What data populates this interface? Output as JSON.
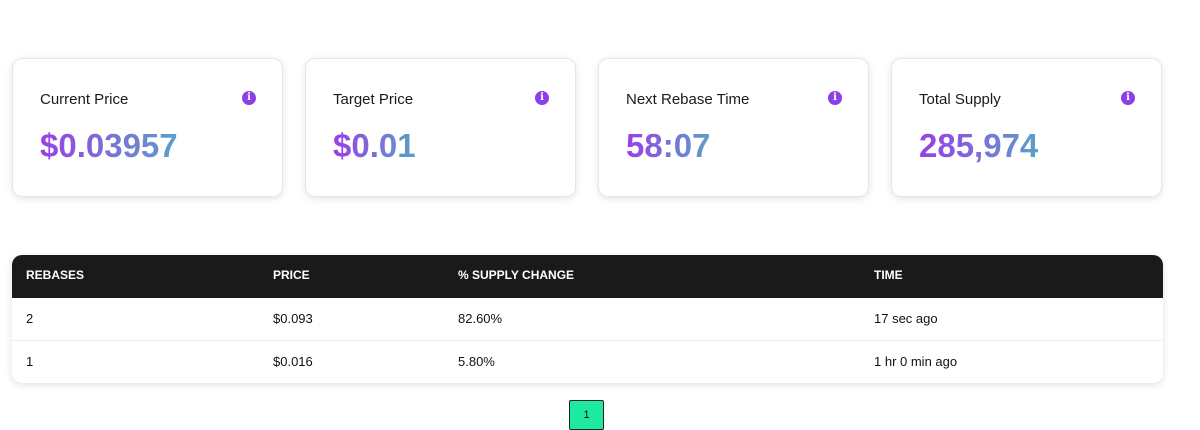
{
  "cards": [
    {
      "label": "Current Price",
      "value": "$0.03957",
      "icon": "info-icon"
    },
    {
      "label": "Target Price",
      "value": "$0.01",
      "icon": "info-icon"
    },
    {
      "label": "Next Rebase Time",
      "value": "58:07",
      "icon": "info-icon"
    },
    {
      "label": "Total Supply",
      "value": "285,974",
      "icon": "info-icon"
    }
  ],
  "table": {
    "headers": [
      "REBASES",
      "PRICE",
      "% SUPPLY CHANGE",
      "TIME"
    ],
    "rows": [
      [
        "2",
        "$0.093",
        "82.60%",
        "17 sec ago"
      ],
      [
        "1",
        "$0.016",
        "5.80%",
        "1 hr 0 min ago"
      ]
    ]
  },
  "pagination": {
    "current_page": "1"
  },
  "colors": {
    "accent_purple": "#8b3fe6",
    "gradient_end": "#5aa0c8",
    "header_bg": "#1a1a1a",
    "page_button": "#1de9a0"
  }
}
